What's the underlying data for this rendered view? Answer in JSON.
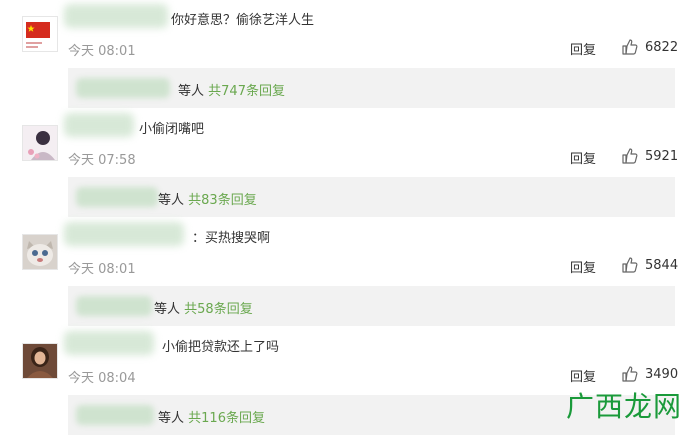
{
  "comments": [
    {
      "text": "你好意思？偷徐艺洋人生",
      "time": "今天 08:01",
      "reply_label": "回复",
      "likes": "6822",
      "sub_suffix": "等人",
      "sub_link": "共747条回复",
      "avatar_icon": "china-flag-icon"
    },
    {
      "text": "小偷闭嘴吧",
      "time": "今天 07:58",
      "reply_label": "回复",
      "likes": "5921",
      "sub_suffix": "等人",
      "sub_link": "共83条回复",
      "avatar_icon": "anime-portrait-icon"
    },
    {
      "text": "：买热搜哭啊",
      "time": "今天 08:01",
      "reply_label": "回复",
      "likes": "5844",
      "sub_suffix": "等人",
      "sub_link": "共58条回复",
      "avatar_icon": "cat-photo-icon"
    },
    {
      "text": "小偷把贷款还上了吗",
      "time": "今天 08:04",
      "reply_label": "回复",
      "likes": "3490",
      "sub_suffix": "等人",
      "sub_link": "共116条回复",
      "avatar_icon": "girl-photo-icon"
    }
  ],
  "watermark": "广西龙网",
  "colors": {
    "link": "#6aa84f",
    "subbox": "#f2f2f2",
    "time": "#999999",
    "watermark": "#1a9a3a"
  }
}
